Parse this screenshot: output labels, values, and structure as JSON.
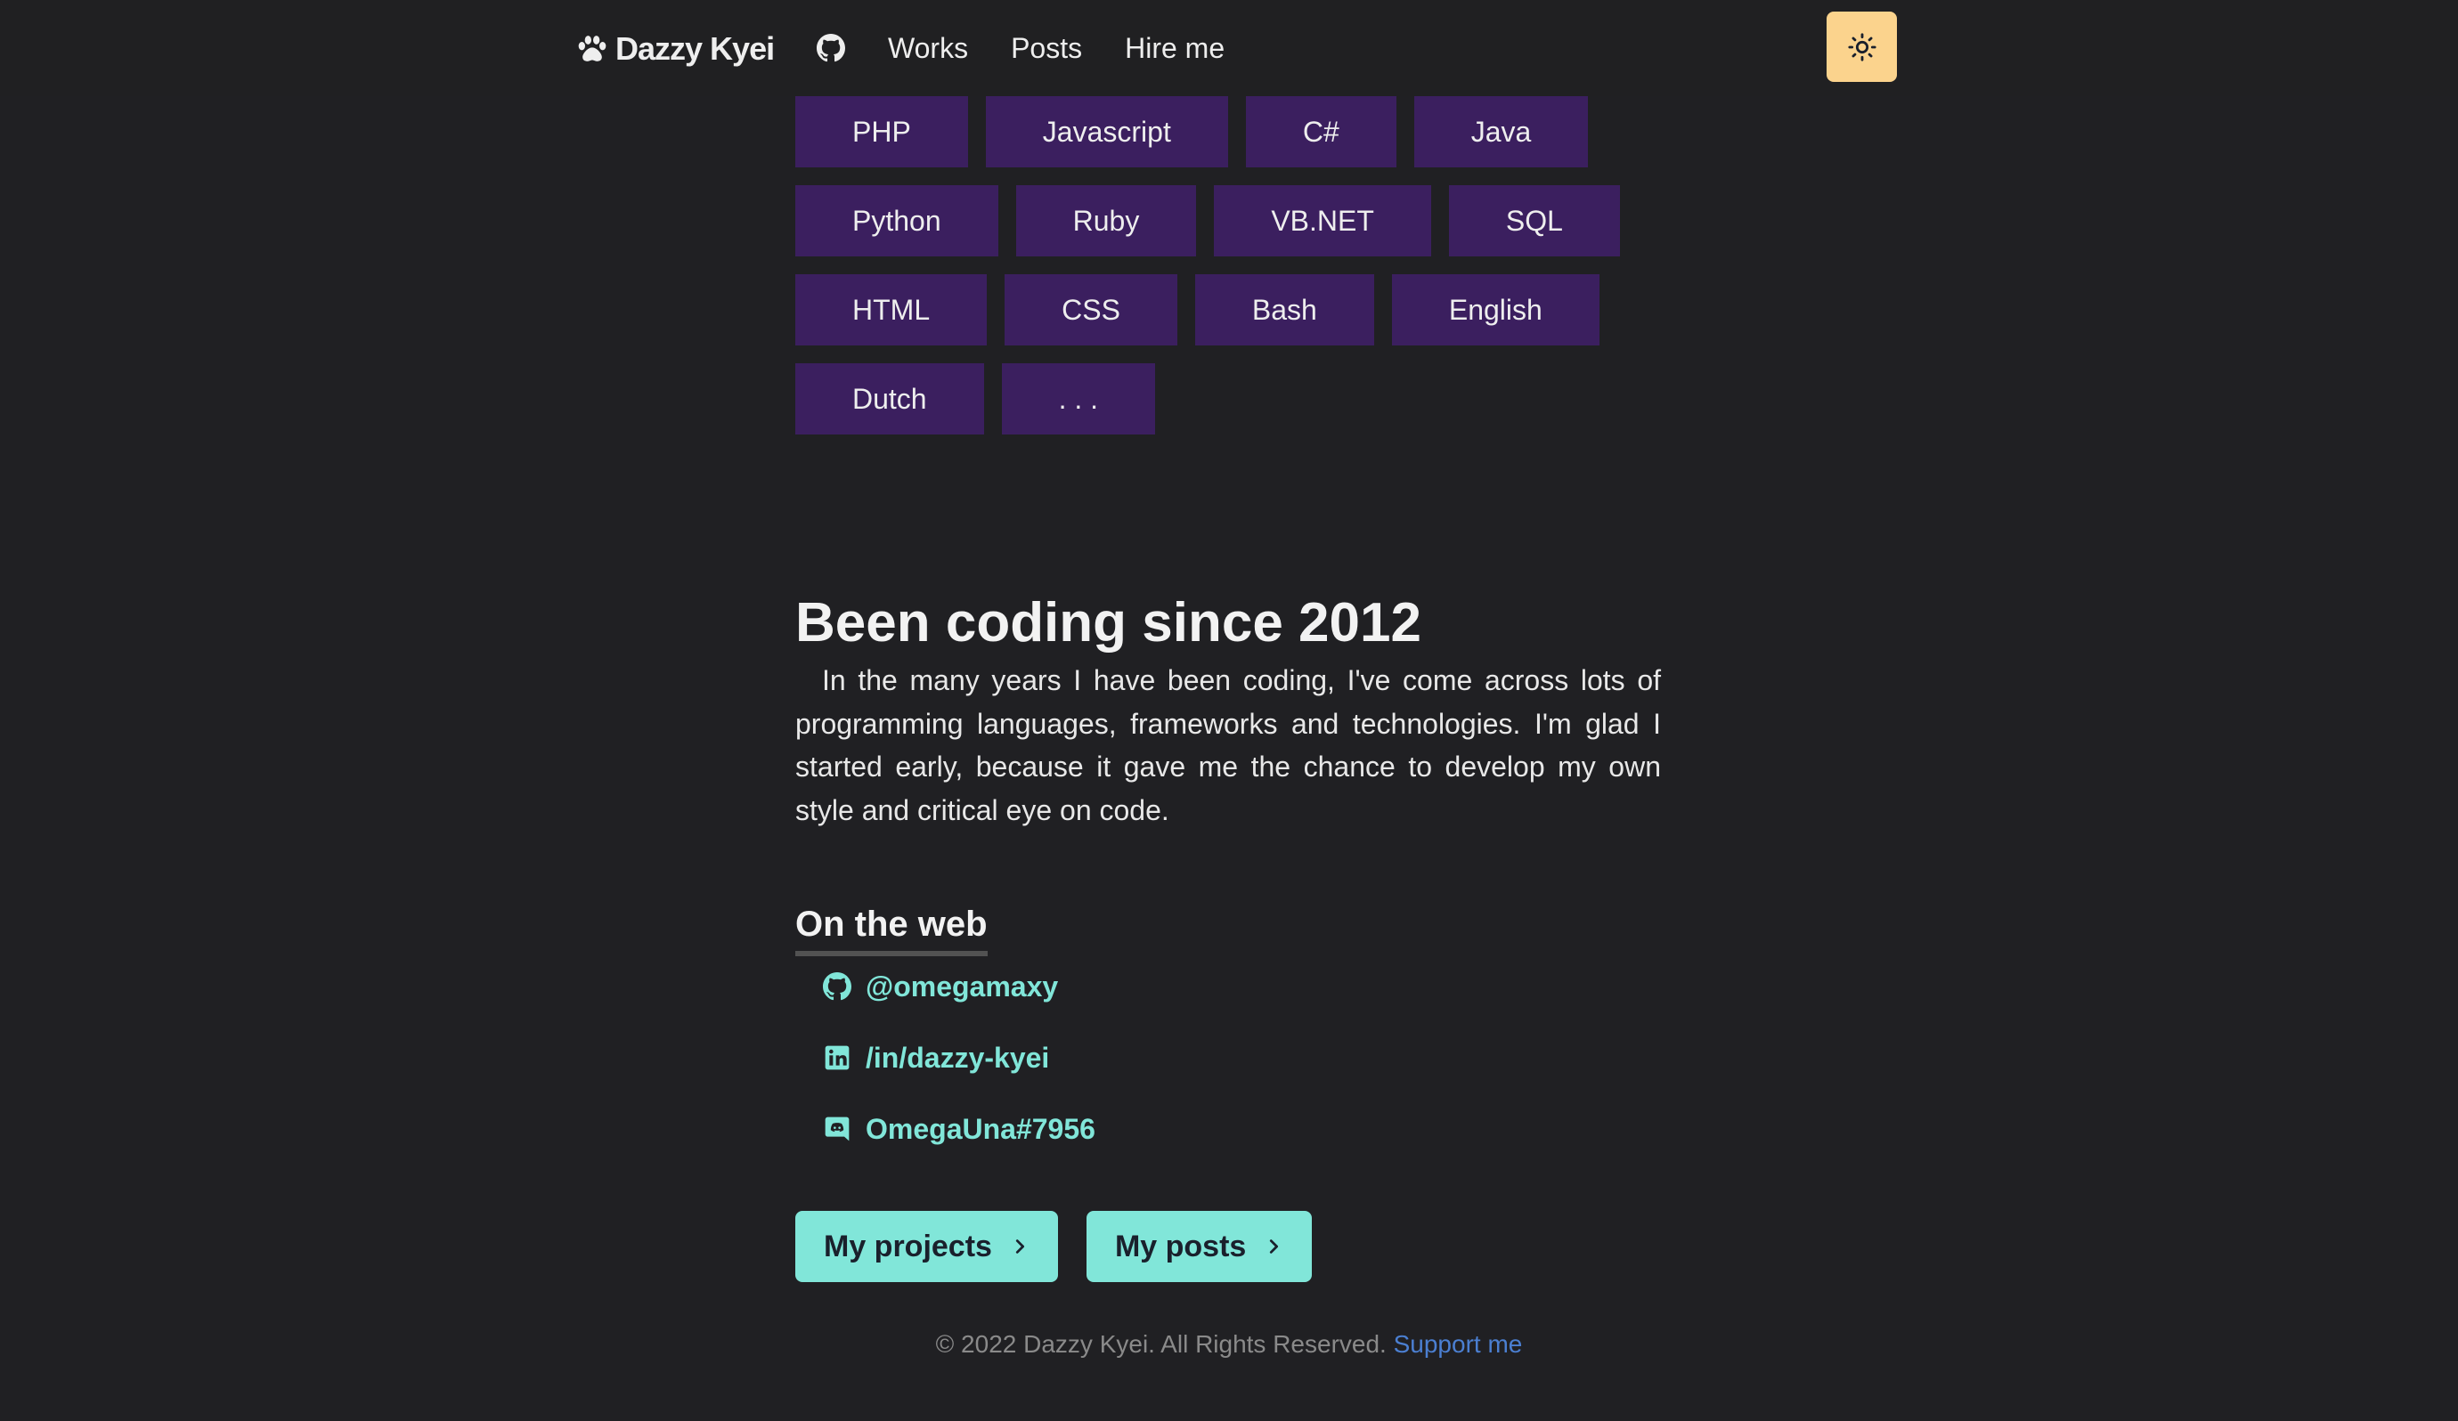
{
  "nav": {
    "brand": "Dazzy Kyei",
    "links": [
      "Works",
      "Posts",
      "Hire me"
    ]
  },
  "tags": [
    [
      "PHP",
      "Javascript",
      "C#",
      "Java"
    ],
    [
      "Python",
      "Ruby",
      "VB.NET",
      "SQL"
    ],
    [
      "HTML",
      "CSS",
      "Bash",
      "English"
    ],
    [
      "Dutch",
      ". . ."
    ]
  ],
  "section": {
    "title": "Been coding since 2012",
    "paragraph": "In the many years I have been coding, I've come across lots of programming languages, frameworks and technologies. I'm glad I started early, because it gave me the chance to develop my own style and critical eye on code."
  },
  "web": {
    "heading": "On the web",
    "links": [
      {
        "icon": "github-icon",
        "label": "@omegamaxy"
      },
      {
        "icon": "linkedin-icon",
        "label": "/in/dazzy-kyei"
      },
      {
        "icon": "discord-icon",
        "label": "OmegaUna#7956"
      }
    ]
  },
  "buttons": {
    "projects": "My projects",
    "posts": "My posts"
  },
  "footer": {
    "copyright": "© 2022 Dazzy Kyei. All Rights Reserved.",
    "support": "Support me"
  },
  "colors": {
    "background": "#202023",
    "tag_bg": "#3b1f5f",
    "accent": "#81e6d9",
    "theme_toggle": "#fbd38d",
    "footer_link": "#4b7fd1"
  }
}
